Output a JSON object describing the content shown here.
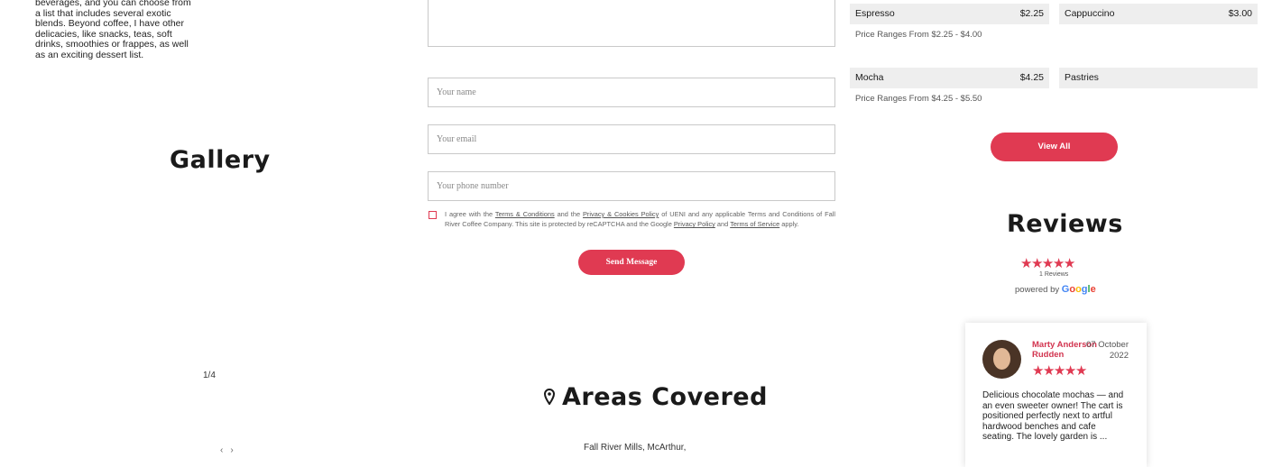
{
  "about": {
    "text": "beverages, and you can choose from a list that includes several exotic blends. Beyond coffee, I have other delicacies, like snacks, teas, soft drinks, smoothies or frappes, as well as an exciting dessert list."
  },
  "gallery": {
    "title": "Gallery",
    "counter": "1/4"
  },
  "contact_form": {
    "name_placeholder": "Your name",
    "email_placeholder": "Your email",
    "phone_placeholder": "Your phone number",
    "consent": {
      "part1": "I agree with the ",
      "terms_link": "Terms & Conditions",
      "part2": " and the ",
      "privacy_cookies_link": "Privacy & Cookies Policy",
      "part3": " of UENI and any applicable Terms and Conditions of Fall River Coffee Company. This site is protected by reCAPTCHA and the Google ",
      "google_privacy_link": "Privacy Policy",
      "part4": " and ",
      "google_terms_link": "Terms of Service",
      "part5": " apply."
    },
    "send_label": "Send Message"
  },
  "areas": {
    "title": "Areas Covered",
    "list": "Fall River Mills, McArthur,"
  },
  "menu": {
    "items": [
      {
        "name": "Espresso",
        "price": "$2.25",
        "range": "Price Ranges From $2.25 - $4.00"
      },
      {
        "name": "Cappuccino",
        "price": "$3.00"
      },
      {
        "name": "Mocha",
        "price": "$4.25",
        "range": "Price Ranges From $4.25 - $5.50"
      },
      {
        "name": "Pastries"
      }
    ],
    "view_all_label": "View All"
  },
  "reviews": {
    "title": "Reviews",
    "rating": 5,
    "count_label": "1 Reviews",
    "powered_by": "powered by",
    "google": "Google",
    "review": {
      "author": "Marty Anderson Rudden",
      "date": "07 October 2022",
      "rating": 5,
      "text": "Delicious chocolate mochas — and an even sweeter owner! The cart is positioned perfectly next to artful hardwood benches and cafe seating. The lovely garden is ..."
    }
  },
  "colors": {
    "accent": "#e03a52",
    "menu_bar": "#eeeeee"
  }
}
